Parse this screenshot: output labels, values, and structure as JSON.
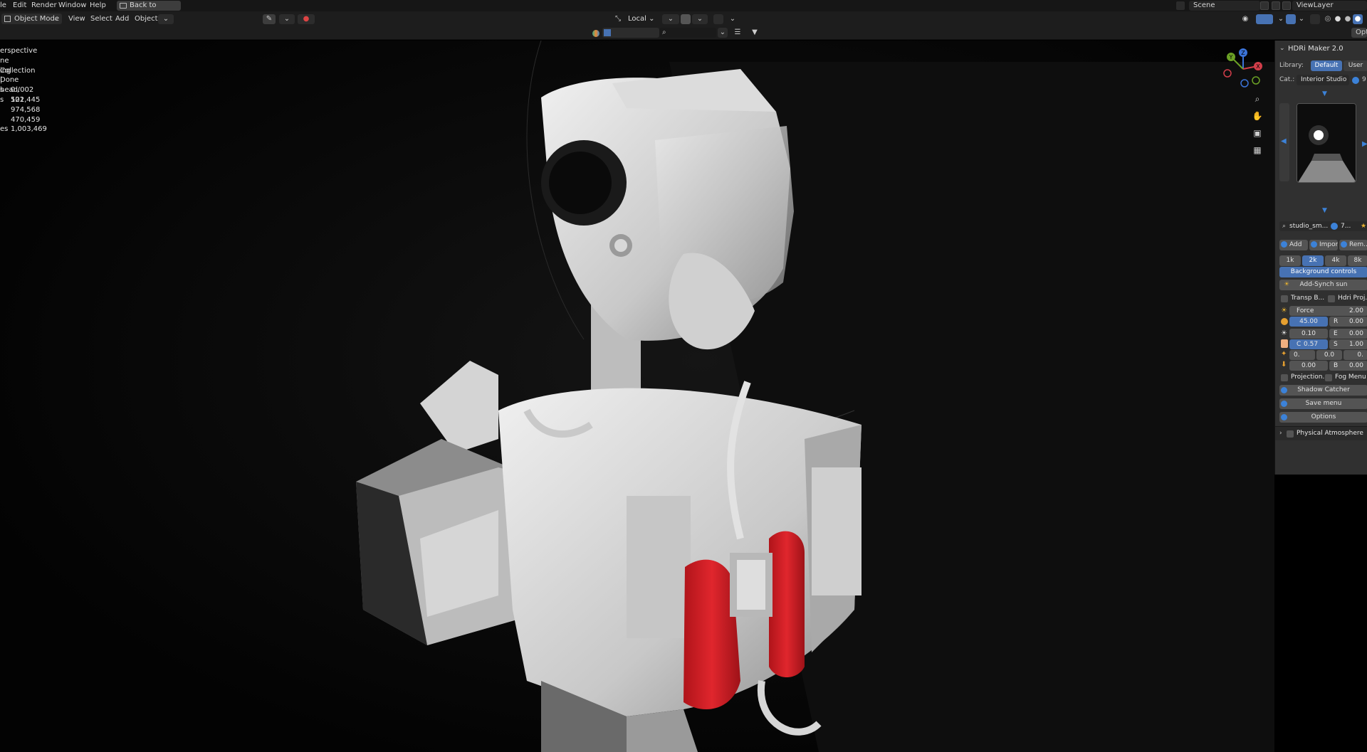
{
  "topbar": {
    "menus": [
      "le",
      "Edit",
      "Render",
      "Window",
      "Help"
    ],
    "back_button": "Back to Previous",
    "scene": "Scene",
    "view_layer": "ViewLayer"
  },
  "header": {
    "mode": "Object Mode",
    "menus": [
      "View",
      "Select",
      "Add",
      "Object"
    ],
    "pivot": "Local"
  },
  "viewport": {
    "overlay_lines": [
      "erspective",
      "ne Collection | head.002",
      "ing Done"
    ],
    "stats": [
      {
        "k": "s",
        "v": "0 / 122"
      },
      {
        "k": "s",
        "v": "501,445"
      },
      {
        "k": "",
        "v": "974,568"
      },
      {
        "k": "",
        "v": "470,459"
      },
      {
        "k": "es",
        "v": "1,003,469"
      }
    ],
    "gizmo": {
      "x": "X",
      "y": "Y",
      "z": "Z"
    }
  },
  "npanel": {
    "top_tab": "Opt",
    "title": "HDRi Maker 2.0",
    "library_label": "Library:",
    "library_default": "Default",
    "library_user": "User",
    "category_label": "Cat.:",
    "category_value": "Interior Studio",
    "category_count": "9",
    "hdri_name": "studio_sm...",
    "hdri_num": "7...",
    "add": "Add",
    "import": "Import",
    "remove": "Rem...",
    "res": [
      "1k",
      "2k",
      "4k",
      "8k"
    ],
    "background_controls": "Background controls",
    "add_synch_sun": "Add-Synch sun",
    "transp": "Transp B...",
    "hdri_proj": "Hdri Proj...",
    "force_label": "Force",
    "force_value": "2.00",
    "rot_value": "45.00",
    "r_label": "R",
    "r_value": "0.00",
    "row_a": {
      "v1": "0.10",
      "lbl": "E",
      "v2": "0.00"
    },
    "row_b": {
      "lbl1": "C",
      "v1": "0.57",
      "lbl": "S",
      "v2": "1.00"
    },
    "row_c": {
      "v1": "0.",
      "v2": "0.0",
      "v3": "0."
    },
    "row_d": {
      "v1": "0.00",
      "lbl": "B",
      "v2": "0.00"
    },
    "projection": "Projection...",
    "fog_menu": "Fog Menu",
    "shadow_catcher": "Shadow Catcher",
    "save_menu": "Save menu",
    "options": "Options",
    "physical_atmosphere": "Physical Atmosphere"
  },
  "colors": {
    "accent": "#4772b3",
    "panel_bg": "#303030",
    "header_bg": "#1d1d1d",
    "red_mesh": "#d42027"
  }
}
